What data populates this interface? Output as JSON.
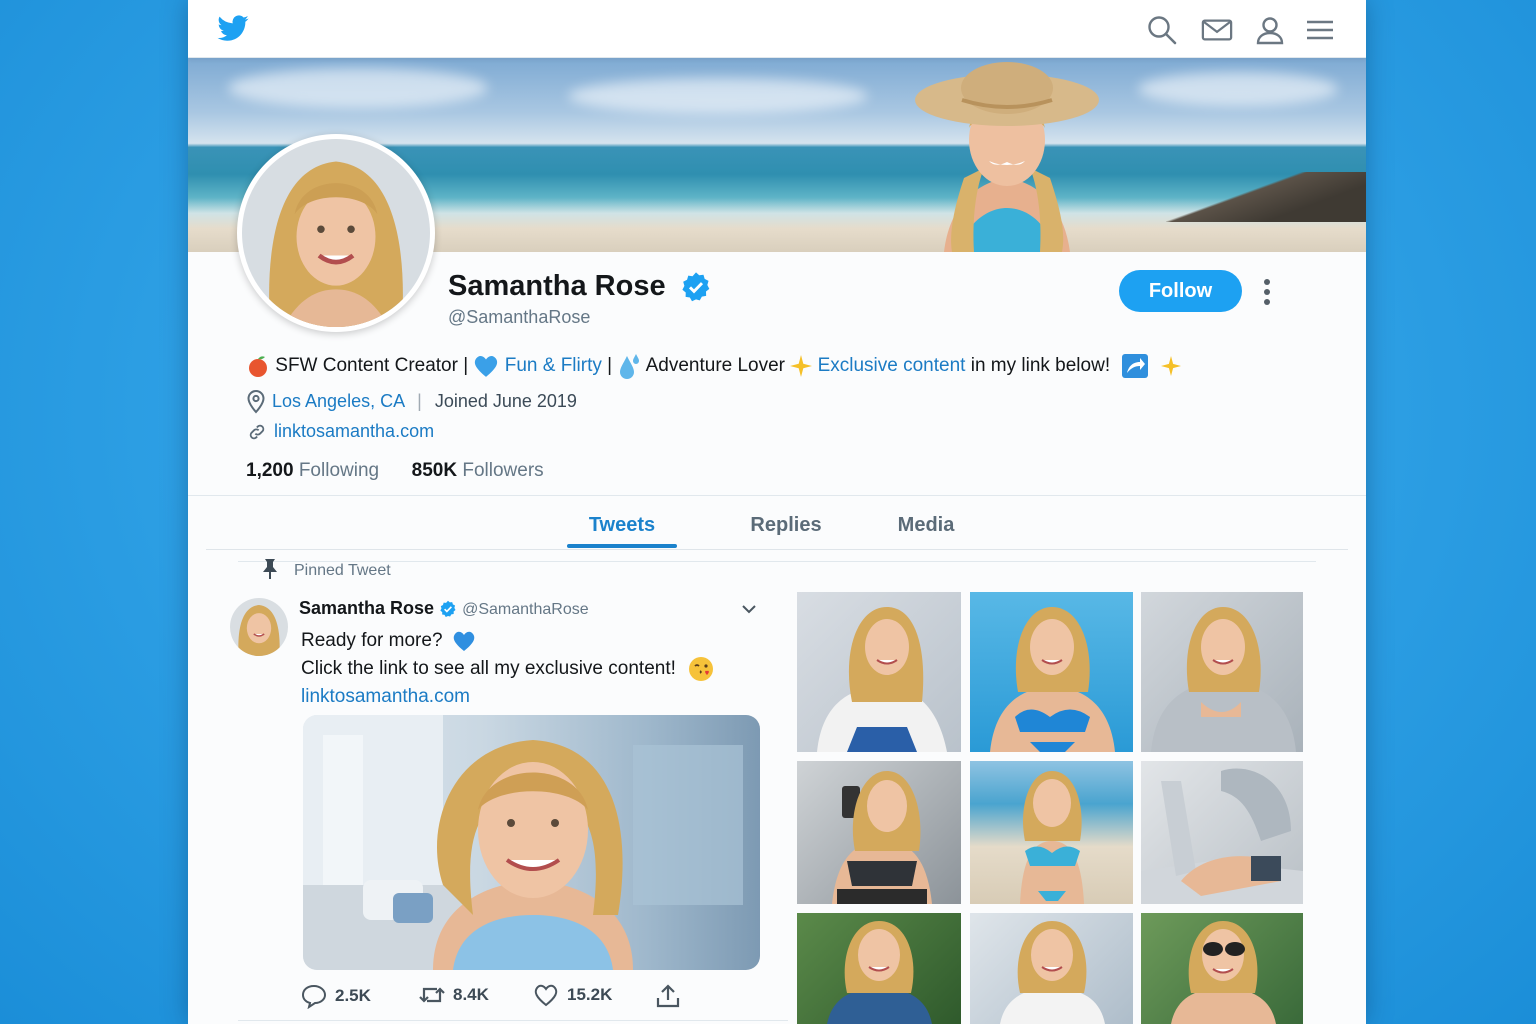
{
  "brand": {
    "logo_icon": "bird-logo-icon",
    "accent": "#1da1f2"
  },
  "nav": {
    "icons": [
      "search-icon",
      "mail-icon",
      "profile-icon",
      "menu-icon"
    ]
  },
  "profile": {
    "name": "Samantha Rose",
    "handle": "@SamanthaRose",
    "verified": true,
    "follow_label": "Follow",
    "bio": {
      "p1": "SFW Content Creator |",
      "p2": "Fun & Flirty",
      "p3": " |",
      "p4": "Adventure Lover",
      "p5": "Exclusive content",
      "p6": " in my link below!"
    },
    "location": "Los Angeles, CA",
    "location_sep": "|",
    "joined": "Joined June 2019",
    "website": "linktosamantha.com",
    "following_count": "1,200",
    "following_label": "Following",
    "followers_count": "850K",
    "followers_label": "Followers"
  },
  "tabs": [
    {
      "label": "Tweets",
      "active": true
    },
    {
      "label": "Replies",
      "active": false
    },
    {
      "label": "Media",
      "active": false
    }
  ],
  "pinned_tweet": {
    "pinned_label": "Pinned Tweet",
    "author": "Samantha Rose",
    "handle": "@SamanthaRose",
    "line1": "Ready for more?",
    "line2": "Click the link to see all my exclusive content!",
    "link": "linktosamantha.com",
    "replies": "2.5K",
    "retweets": "8.4K",
    "likes": "15.2K"
  },
  "media_grid": {
    "columns": 3,
    "rows_visible": 3,
    "tile_count": 9
  }
}
